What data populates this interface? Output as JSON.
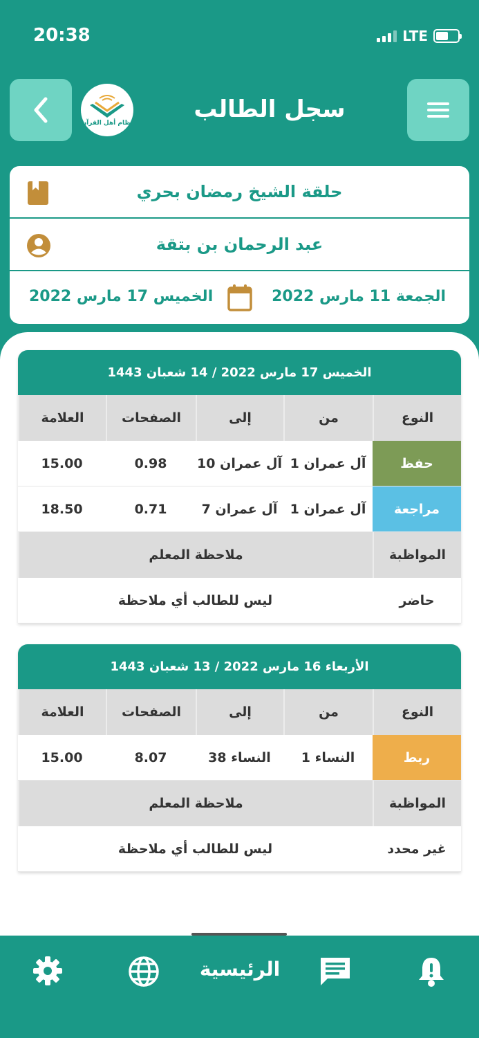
{
  "status_bar": {
    "time": "20:38",
    "network": "LTE"
  },
  "header": {
    "title": "سجل الطالب",
    "logo_text": "نظام أهل القرآن"
  },
  "info": {
    "circle": "حلقة الشيخ رمضان بحري",
    "student": "عبد الرحمان بن بتقة",
    "date_from": "الجمعة 11 مارس 2022",
    "date_to": "الخميس 17 مارس 2022"
  },
  "table_headers": {
    "type": "النوع",
    "from": "من",
    "to": "إلى",
    "pages": "الصفحات",
    "mark": "العلامة",
    "attendance": "المواظبة",
    "teacher_note": "ملاحظة المعلم"
  },
  "records": [
    {
      "date": "الخميس 17 مارس 2022 / 14 شعبان 1443",
      "rows": [
        {
          "type": "حفظ",
          "from": "آل عمران 1",
          "to": "آل عمران 10",
          "pages": "0.98",
          "mark": "15.00"
        },
        {
          "type": "مراجعة",
          "from": "آل عمران 1",
          "to": "آل عمران 7",
          "pages": "0.71",
          "mark": "18.50"
        }
      ],
      "attendance": "حاضر",
      "note": "ليس للطالب أي ملاحظة"
    },
    {
      "date": "الأربعاء 16 مارس 2022 / 13 شعبان 1443",
      "rows": [
        {
          "type": "ربط",
          "from": "النساء 1",
          "to": "النساء 38",
          "pages": "8.07",
          "mark": "15.00"
        }
      ],
      "attendance": "غير محدد",
      "note": "ليس للطالب أي ملاحظة"
    }
  ],
  "bottom_nav": {
    "home_label": "الرئيسية"
  },
  "colors": {
    "primary": "#1a9987",
    "button_light": "#6fd4c3",
    "hifz": "#7d9b56",
    "review": "#5bc0e4",
    "rabt": "#eeae4b",
    "icon_gold": "#c28e3a"
  }
}
